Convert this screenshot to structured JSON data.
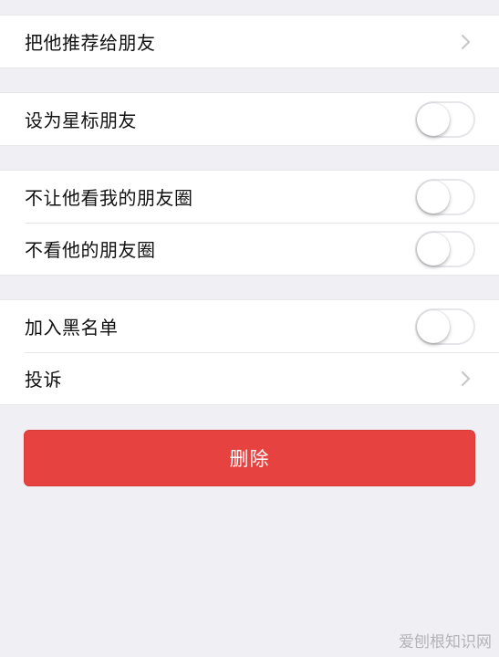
{
  "sections": {
    "recommend": {
      "label": "把他推荐给朋友",
      "control": "chevron"
    },
    "star": {
      "label": "设为星标朋友",
      "control": "switch",
      "on": false
    },
    "hide_my_moments": {
      "label": "不让他看我的朋友圈",
      "control": "switch",
      "on": false
    },
    "hide_his_moments": {
      "label": "不看他的朋友圈",
      "control": "switch",
      "on": false
    },
    "blacklist": {
      "label": "加入黑名单",
      "control": "switch",
      "on": false
    },
    "report": {
      "label": "投诉",
      "control": "chevron"
    }
  },
  "delete_button": {
    "label": "删除"
  },
  "watermark": "爱刨根知识网",
  "colors": {
    "background": "#efeff4",
    "cell": "#ffffff",
    "danger": "#e64340",
    "separator": "#e5e5ea",
    "chevron": "#c7c7cc"
  },
  "icons": {
    "recommend": "chevron-right-icon",
    "report": "chevron-right-icon"
  }
}
